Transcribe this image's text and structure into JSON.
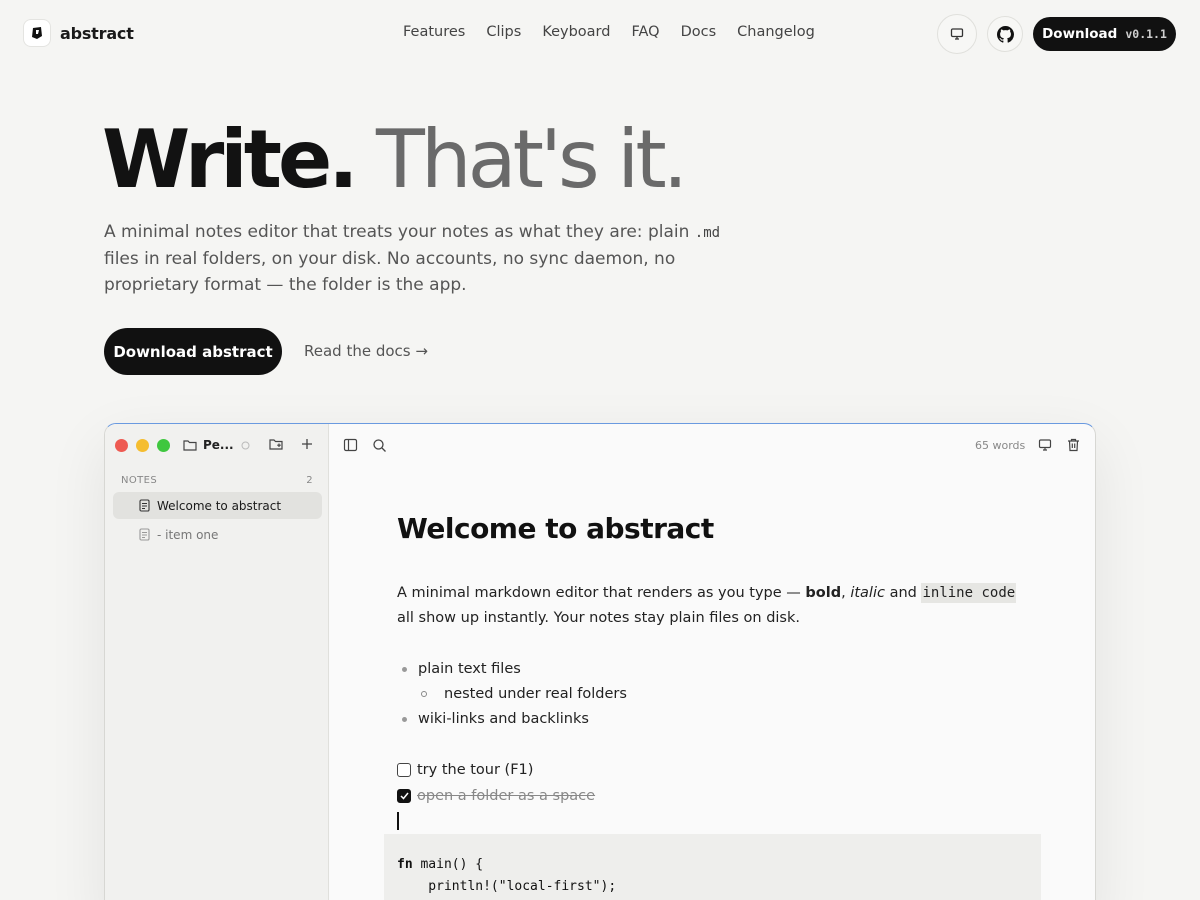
{
  "nav": {
    "brand": "abstract",
    "links": [
      "Features",
      "Clips",
      "Keyboard",
      "FAQ",
      "Docs",
      "Changelog"
    ],
    "download_label": "Download",
    "version": "v0.1.1"
  },
  "hero": {
    "title_bold": "Write.",
    "title_light": "That's it.",
    "subtitle_1": "A minimal notes editor that treats your notes as what they are: plain ",
    "subtitle_code": ".md",
    "subtitle_2": " files in real folders, on your disk. No accounts, no sync daemon, no proprietary format — the folder is the app.",
    "cta": "Download abstract",
    "docs_link": "Read the docs →"
  },
  "app": {
    "folder_name": "Pe...",
    "notes_header": "NOTES",
    "notes_count": "2",
    "notes": [
      {
        "title": "Welcome to abstract"
      },
      {
        "title": "- item one"
      }
    ],
    "word_count": "65 words",
    "doc": {
      "title": "Welcome to abstract",
      "para_1": "A minimal markdown editor that renders as you type — ",
      "para_bold": "bold",
      "para_comma": ", ",
      "para_italic": "italic",
      "para_and": " and ",
      "para_code": "inline code",
      "para_2": " all show up instantly. Your notes stay plain files on disk.",
      "bullets": [
        "plain text files",
        "nested under real folders",
        "wiki-links and backlinks"
      ],
      "tasks": [
        {
          "text": "try the tour (F1)",
          "done": false
        },
        {
          "text": "open a folder as a space",
          "done": true
        }
      ],
      "code_kw": "fn",
      "code_line_1": " main() {",
      "code_line_2": "    println!(\"local-first\");"
    }
  },
  "colors": {
    "traffic_red": "#ee5a52",
    "traffic_yellow": "#f5bd2f",
    "traffic_green": "#3fc73f",
    "accent_border": "#6a9ae0"
  }
}
